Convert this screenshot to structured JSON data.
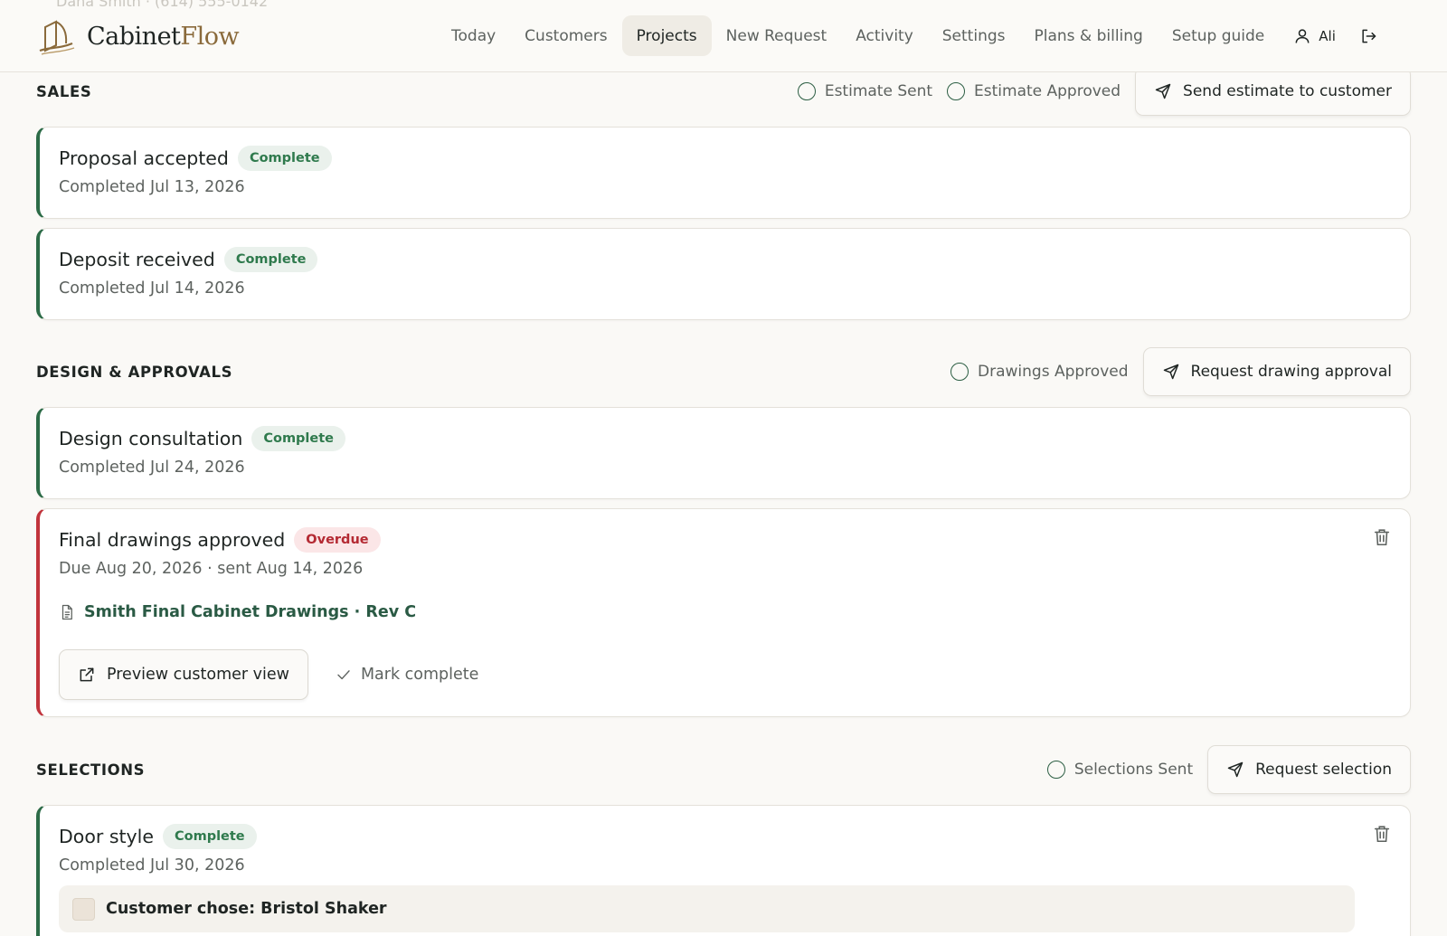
{
  "header": {
    "ghost_text": "Dana Smith · (614) 555-0142",
    "brand": {
      "name_main": "Cabinet",
      "name_accent": "Flow"
    },
    "nav": [
      {
        "label": "Today",
        "active": false
      },
      {
        "label": "Customers",
        "active": false
      },
      {
        "label": "Projects",
        "active": true
      },
      {
        "label": "New Request",
        "active": false
      },
      {
        "label": "Activity",
        "active": false
      },
      {
        "label": "Settings",
        "active": false
      },
      {
        "label": "Plans & billing",
        "active": false
      },
      {
        "label": "Setup guide",
        "active": false
      }
    ],
    "user": {
      "name": "Ali",
      "icon": "user-icon"
    },
    "logout_icon": "logout-icon"
  },
  "sections": {
    "sales": {
      "title": "SALES",
      "statuses": [
        "Estimate Sent",
        "Estimate Approved"
      ],
      "action_label": "Send estimate to customer",
      "cards": [
        {
          "title": "Proposal accepted",
          "badge": "Complete",
          "subtitle": "Completed Jul 13, 2026"
        },
        {
          "title": "Deposit received",
          "badge": "Complete",
          "subtitle": "Completed Jul 14, 2026"
        }
      ]
    },
    "design": {
      "title": "DESIGN & APPROVALS",
      "statuses": [
        "Drawings Approved"
      ],
      "action_label": "Request drawing approval",
      "cards": [
        {
          "title": "Design consultation",
          "badge": "Complete",
          "subtitle": "Completed Jul 24, 2026"
        },
        {
          "title": "Final drawings approved",
          "badge": "Overdue",
          "subtitle": "Due Aug 20, 2026 · sent Aug 14, 2026",
          "document": "Smith Final Cabinet Drawings · Rev C",
          "preview_label": "Preview customer view",
          "complete_label": "Mark complete"
        }
      ]
    },
    "selections": {
      "title": "SELECTIONS",
      "statuses": [
        "Selections Sent"
      ],
      "action_label": "Request selection",
      "cards": [
        {
          "title": "Door style",
          "badge": "Complete",
          "subtitle": "Completed Jul 30, 2026",
          "choice": "Customer chose: Bristol Shaker"
        }
      ]
    }
  },
  "colors": {
    "accent_green": "#2c6b47",
    "overdue_red": "#c1343c",
    "brand_gold": "#8a6a3b",
    "background": "#faf9f6"
  }
}
